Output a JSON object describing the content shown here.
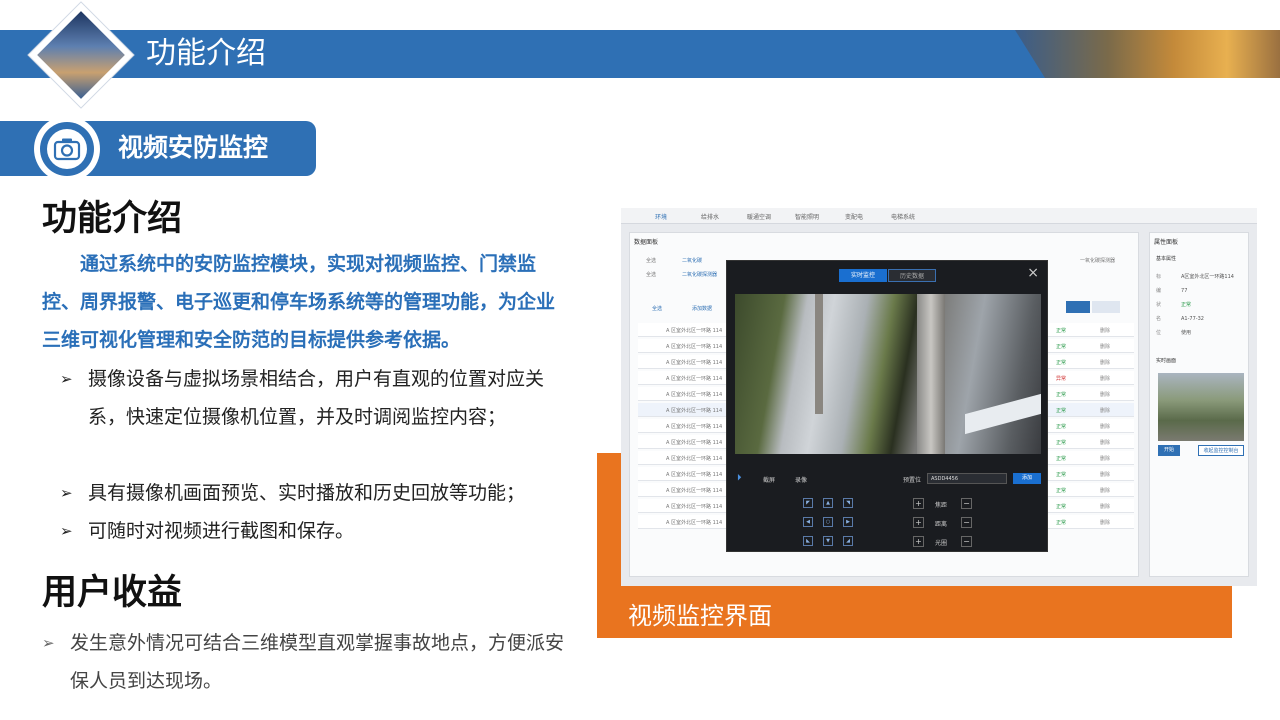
{
  "header": {
    "title": "功能介绍"
  },
  "section": {
    "title": "视频安防监控"
  },
  "intro": {
    "heading": "功能介绍",
    "paragraph": "通过系统中的安防监控模块，实现对视频监控、门禁监控、周界报警、电子巡更和停车场系统等的管理功能，为企业三维可视化管理和安全防范的目标提供参考依据。",
    "bullets": [
      "摄像设备与虚拟场景相结合，用户有直观的位置对应关系，快速定位摄像机位置，并及时调阅监控内容；",
      "具有摄像机画面预览、实时播放和历史回放等功能；",
      "可随时对视频进行截图和保存。"
    ]
  },
  "benefits": {
    "heading": "用户收益",
    "items": [
      "发生意外情况可结合三维模型直观掌握事故地点，方便派安保人员到达现场。"
    ]
  },
  "figure": {
    "caption": "视频监控界面"
  },
  "screenshot": {
    "nav": [
      "环境",
      "给排水",
      "暖通空调",
      "智能照明",
      "变配电",
      "电梯系统"
    ],
    "data_panel_title": "数据面板",
    "options": [
      "全选",
      "二氧化碳",
      "全选",
      "二氧化碳探测器",
      "一氧化碳探测器"
    ],
    "select_all": "全选",
    "add_data": "添加数据",
    "rows": [
      {
        "name": "A 区室外北区一环路 114",
        "status": "正常",
        "action": "删除"
      },
      {
        "name": "A 区室外北区一环路 114",
        "status": "正常",
        "action": "删除"
      },
      {
        "name": "A 区室外北区一环路 114",
        "status": "正常",
        "action": "删除"
      },
      {
        "name": "A 区室外北区一环路 114",
        "status": "异常",
        "action": "删除"
      },
      {
        "name": "A 区室外北区一环路 114",
        "status": "正常",
        "action": "删除"
      },
      {
        "name": "A 区室外北区一环路 114",
        "status": "正常",
        "action": "删除"
      },
      {
        "name": "A 区室外北区一环路 114",
        "status": "正常",
        "action": "删除"
      },
      {
        "name": "A 区室外北区一环路 114",
        "status": "正常",
        "action": "删除"
      },
      {
        "name": "A 区室外北区一环路 114",
        "status": "正常",
        "action": "删除"
      },
      {
        "name": "A 区室外北区一环路 114",
        "status": "正常",
        "action": "删除"
      },
      {
        "name": "A 区室外北区一环路 114",
        "status": "正常",
        "action": "删除"
      },
      {
        "name": "A 区室外北区一环路 114",
        "status": "正常",
        "action": "删除"
      },
      {
        "name": "A 区室外北区一环路 114",
        "status": "正常",
        "action": "删除"
      }
    ],
    "prop_panel_title": "属性面板",
    "prop_basic": "基本属性",
    "props": [
      {
        "k": "标",
        "v": "A区室外北区一环路114"
      },
      {
        "k": "编",
        "v": "77"
      },
      {
        "k": "状",
        "v": "正常"
      },
      {
        "k": "名",
        "v": "A1-77-32"
      },
      {
        "k": "位",
        "v": "使用"
      }
    ],
    "prop_live": "实时画面",
    "prop_start": "开始",
    "prop_stop": "收起监控控制台",
    "modal": {
      "tab_live": "实时监控",
      "tab_history": "历史数据",
      "close": "×",
      "screenshot_label": "截屏",
      "record_label": "录像",
      "preset_label": "预置位",
      "preset_value": "ASDD4456",
      "add_label": "添加",
      "lens": [
        "焦距",
        "距离",
        "光圈"
      ]
    }
  }
}
